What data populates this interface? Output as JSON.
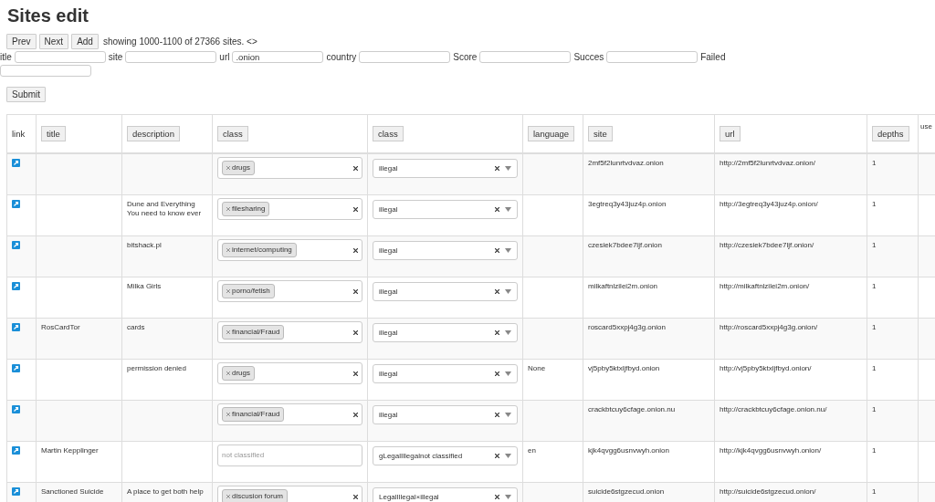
{
  "page": {
    "title": "Sites edit"
  },
  "pager": {
    "buttons": [
      "Prev",
      "Next",
      "Add"
    ],
    "summary": "showing 1000-1100 of 27366 sites. <>"
  },
  "filters": [
    {
      "label": "itle"
    },
    {
      "label": "site"
    },
    {
      "label": "url",
      "value": ".onion"
    },
    {
      "label": "country"
    },
    {
      "label": "Score"
    },
    {
      "label": "Succes"
    },
    {
      "label": "Failed"
    }
  ],
  "submit": "Submit",
  "table": {
    "columns": [
      {
        "label": "link",
        "sortable": false
      },
      {
        "label": "title",
        "sortable": true
      },
      {
        "label": "description",
        "sortable": true
      },
      {
        "label": "class",
        "sortable": true
      },
      {
        "label": "class",
        "sortable": true
      },
      {
        "label": "language",
        "sortable": true
      },
      {
        "label": "site",
        "sortable": true
      },
      {
        "label": "url",
        "sortable": true
      },
      {
        "label": "depths",
        "sortable": true
      },
      {
        "label": "use",
        "sortable": false
      }
    ],
    "rows": [
      {
        "classes": [
          "drugs"
        ],
        "level": "illegal",
        "site": "2mf5f2lunrtvdvaz.onion",
        "url": "http://2mf5f2lunrtvdvaz.onion/",
        "depths": "1"
      },
      {
        "description": "Dune and Everything You need to know ever",
        "classes": [
          "filesharing"
        ],
        "level": "illegal",
        "site": "3egtreq3y43juz4p.onion",
        "url": "http://3egtreq3y43juz4p.onion/",
        "depths": "1"
      },
      {
        "description": "bitshack.pl",
        "classes": [
          "internet/computing"
        ],
        "level": "illegal",
        "site": "czesiek7bdee7ljf.onion",
        "url": "http://czesiek7bdee7ljf.onion/",
        "depths": "1"
      },
      {
        "description": "Milka Girls",
        "classes": [
          "porno/fetish"
        ],
        "level": "illegal",
        "site": "milkaftnlzilei2m.onion",
        "url": "http://milkaftnlzilei2m.onion/",
        "depths": "1"
      },
      {
        "title": "RosCardTor",
        "description": "cards",
        "classes": [
          "financial/Fraud"
        ],
        "level": "illegal",
        "site": "roscard5xxpj4g3g.onion",
        "url": "http://roscard5xxpj4g3g.onion/",
        "depths": "1"
      },
      {
        "description": "permission denied",
        "classes": [
          "drugs"
        ],
        "level": "illegal",
        "language": "None",
        "site": "vj5pby5ktxljfbyd.onion",
        "url": "http://vj5pby5ktxljfbyd.onion/",
        "depths": "1"
      },
      {
        "classes": [
          "financial/Fraud"
        ],
        "level": "illegal",
        "site": "crackbtcuy6cfage.onion.nu",
        "url": "http://crackbtcuy6cfage.onion.nu/",
        "depths": "1"
      },
      {
        "title": "Martin Kepplinger",
        "class_placeholder": "not classified",
        "level": "gLegalIllegalnot classified",
        "language": "en",
        "site": "kjk4qvgg6usnvwyh.onion",
        "url": "http://kjk4qvgg6usnvwyh.onion/",
        "depths": "1"
      },
      {
        "title": "Sanctioned Suicide",
        "description": "A place to get both help",
        "classes": [
          "discusion forum"
        ],
        "level": "LegalIllegal×illegal",
        "site": "suicide6stgzecud.onion",
        "url": "http://suicide6stgzecud.onion/",
        "depths": "1"
      }
    ]
  }
}
